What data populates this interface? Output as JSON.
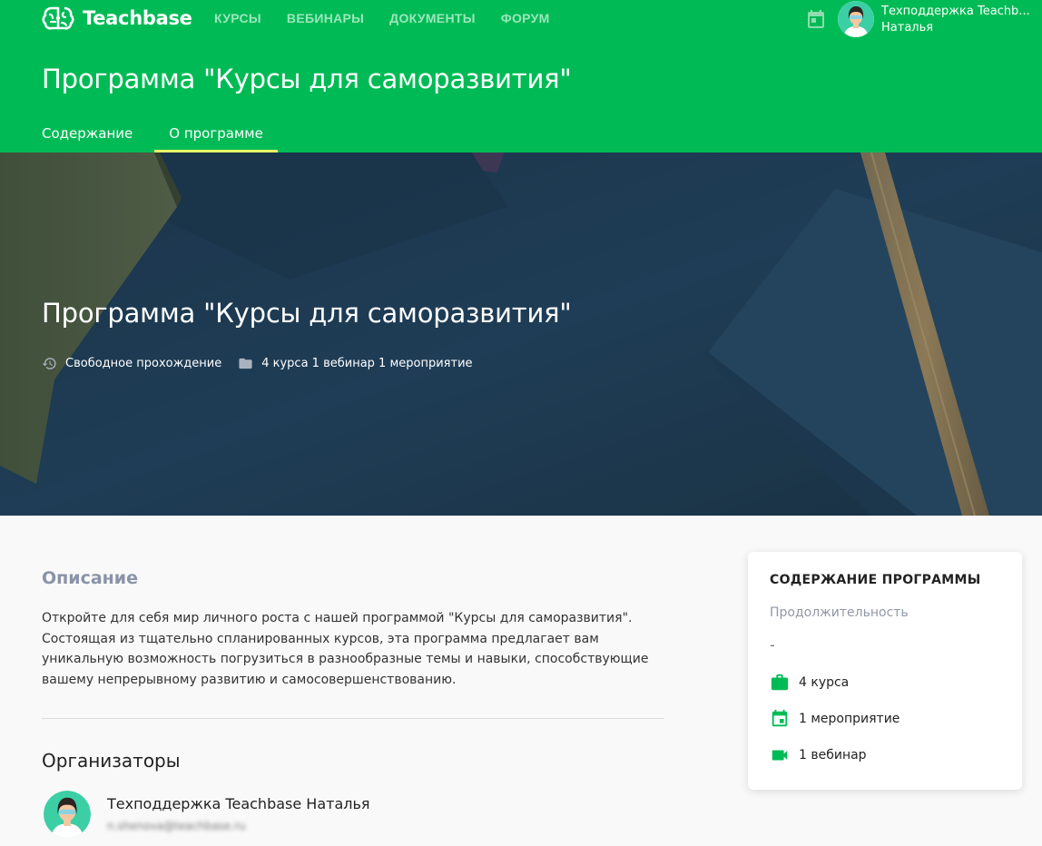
{
  "brand": {
    "name": "Teachbase",
    "accent": "#00bb55",
    "tab_underline": "#e9f36a"
  },
  "nav": {
    "items": [
      {
        "label": "КУРСЫ"
      },
      {
        "label": "ВЕБИНАРЫ"
      },
      {
        "label": "ДОКУМЕНТЫ"
      },
      {
        "label": "ФОРУМ"
      }
    ]
  },
  "user": {
    "name_line1": "Техподдержка Teachb...",
    "name_line2": "Наталья",
    "icons": [
      "calendar-icon",
      "user-avatar"
    ]
  },
  "page": {
    "title": "Программа \"Курсы для саморазвития\""
  },
  "tabs": [
    {
      "label": "Содержание",
      "active": false
    },
    {
      "label": "О программе",
      "active": true
    }
  ],
  "hero": {
    "title": "Программа \"Курсы для саморазвития\"",
    "mode": "Свободное прохождение",
    "contents": "4 курса 1 вебинар 1 мероприятие"
  },
  "description": {
    "title": "Описание",
    "text": "Откройте для себя мир личного роста с нашей программой \"Курсы для саморазвития\". Состоящая из тщательно спланированных курсов, эта программа предлагает вам уникальную возможность погрузиться в разнообразные темы и навыки, способствующие вашему непрерывному развитию и самосовершенствованию."
  },
  "organizers": {
    "title": "Организаторы",
    "items": [
      {
        "name": "Техподдержка Teachbase Наталья",
        "email": "n.shenova@teachbase.ru"
      }
    ]
  },
  "program_card": {
    "title": "СОДЕРЖАНИЕ ПРОГРАММЫ",
    "duration_label": "Продолжительность",
    "duration_value": "-",
    "rows": [
      {
        "icon": "briefcase-icon",
        "label": "4 курса"
      },
      {
        "icon": "calendar-event-icon",
        "label": "1 мероприятие"
      },
      {
        "icon": "video-camera-icon",
        "label": "1 вебинар"
      }
    ]
  }
}
